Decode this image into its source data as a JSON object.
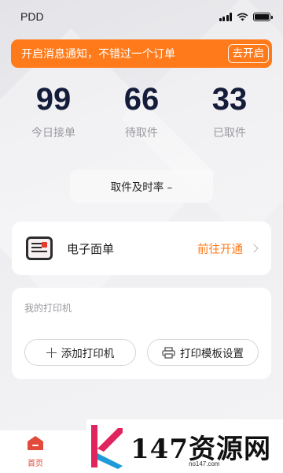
{
  "status_bar": {
    "carrier": "PDD"
  },
  "notice": {
    "text": "开启消息通知，不错过一个订单",
    "button": "去开启"
  },
  "stats": [
    {
      "value": "99",
      "label": "今日接单"
    },
    {
      "value": "66",
      "label": "待取件"
    },
    {
      "value": "33",
      "label": "已取件"
    }
  ],
  "rate": {
    "label": "取件及时率 –"
  },
  "eface": {
    "title": "电子面单",
    "link": "前往开通"
  },
  "printer": {
    "title": "我的打印机",
    "add_label": "添加打印机",
    "template_label": "打印模板设置"
  },
  "tabbar": {
    "home_label": "首页"
  },
  "watermark": {
    "text": "147资源网",
    "sub": "no147.com"
  },
  "colors": {
    "accent": "#ff7a1a",
    "stat_number": "#141c3a",
    "home_icon": "#e24b3b"
  }
}
